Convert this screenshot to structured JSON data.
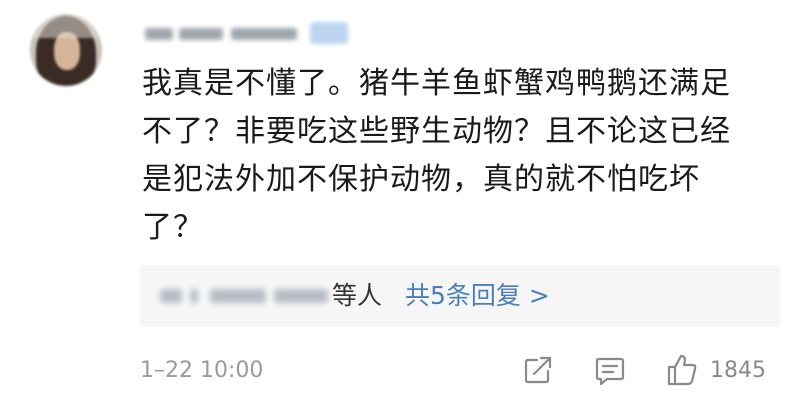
{
  "comment": {
    "body": "我真是不懂了。猪牛羊鱼虾蟹鸡鸭鹅还满足\n不了？非要吃这些野生动物？且不论这已经\n是犯法外加不保护动物，真的就不怕吃坏\n了？",
    "timestamp": "1–22 10:00",
    "likes": "1845"
  },
  "replies": {
    "names_suffix": "等人",
    "link_label": "共5条回复 >"
  },
  "colors": {
    "text": "#1a1a1a",
    "link": "#4a7fb8",
    "meta": "#9a9a9a",
    "reply_bg": "#f6f6f6"
  },
  "icons": {
    "share": "share-icon",
    "comment": "comment-icon",
    "like": "thumbs-up-icon"
  }
}
